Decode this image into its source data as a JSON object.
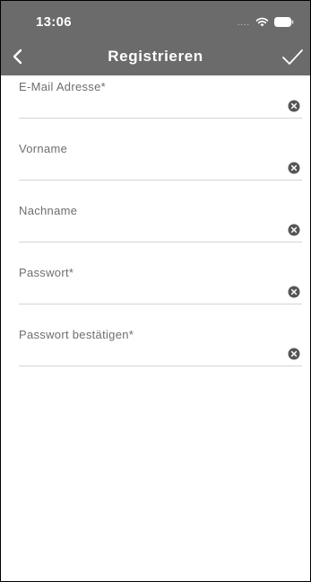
{
  "status_bar": {
    "time": "13:06",
    "signal": "....",
    "icons": [
      "wifi-icon",
      "battery-icon"
    ]
  },
  "nav": {
    "title": "Registrieren",
    "back_icon": "chevron-left-icon",
    "confirm_icon": "checkmark-icon"
  },
  "form": {
    "fields": [
      {
        "label": "E-Mail Adresse*",
        "value": "",
        "clear_icon": "clear-icon"
      },
      {
        "label": "Vorname",
        "value": "",
        "clear_icon": "clear-icon"
      },
      {
        "label": "Nachname",
        "value": "",
        "clear_icon": "clear-icon"
      },
      {
        "label": "Passwort*",
        "value": "",
        "clear_icon": "clear-icon"
      },
      {
        "label": "Passwort bestätigen*",
        "value": "",
        "clear_icon": "clear-icon"
      }
    ]
  },
  "colors": {
    "header_bg": "#6b6b6b",
    "header_text": "#ffffff",
    "label_text": "#6e6e6e",
    "divider": "#d4d4d4",
    "clear_icon": "#555555"
  }
}
